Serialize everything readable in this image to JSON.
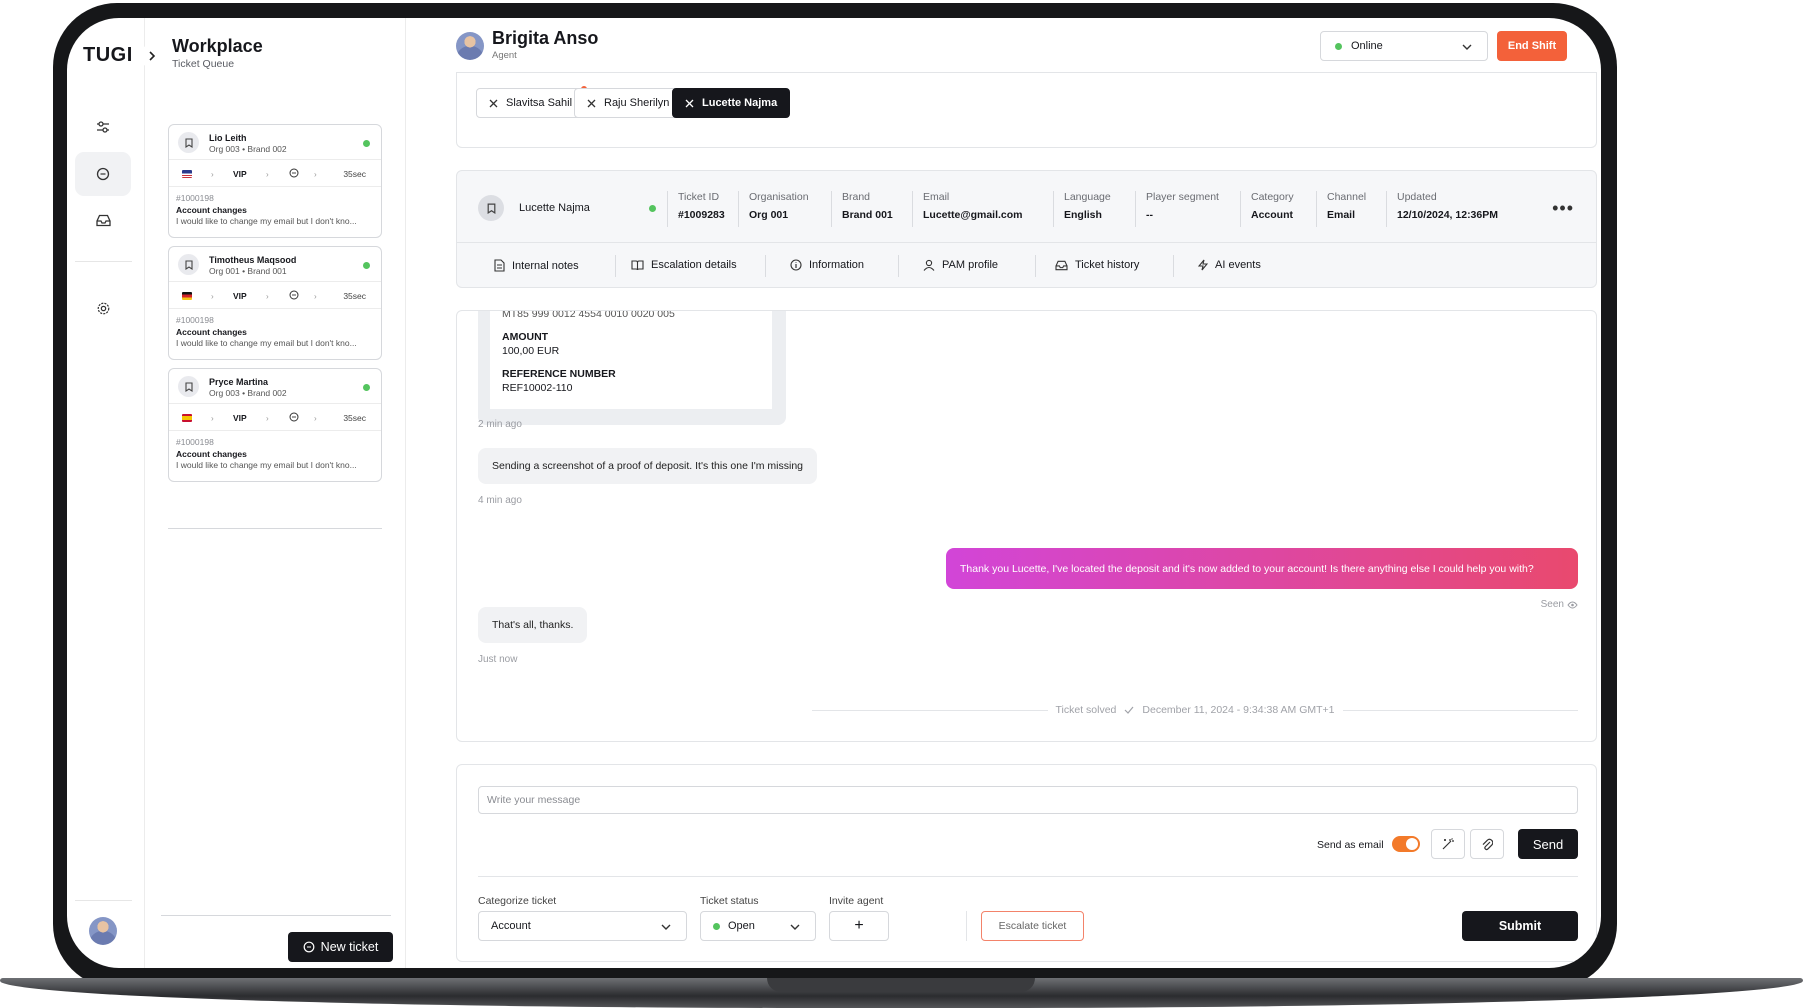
{
  "app": {
    "logo": "TUGI"
  },
  "queue": {
    "title": "Workplace",
    "subtitle": "Ticket Queue",
    "new_ticket_label": "New ticket",
    "tickets": [
      {
        "name": "Lio Leith",
        "org": "Org 003 • Brand 002",
        "flag": "us",
        "tier": "VIP",
        "wait": "35sec",
        "id": "#1000198",
        "category": "Account changes",
        "preview": "I would like to change my email but I don't kno..."
      },
      {
        "name": "Timotheus Maqsood",
        "org": "Org 001 • Brand 001",
        "flag": "de",
        "tier": "VIP",
        "wait": "35sec",
        "id": "#1000198",
        "category": "Account changes",
        "preview": "I would like to change my email but I don't kno..."
      },
      {
        "name": "Pryce Martina",
        "org": "Org 003 • Brand 002",
        "flag": "es",
        "tier": "VIP",
        "wait": "35sec",
        "id": "#1000198",
        "category": "Account changes",
        "preview": "I would like to change my email but I don't kno..."
      }
    ]
  },
  "header": {
    "agent_name": "Brigita Anso",
    "agent_role": "Agent",
    "status": "Online",
    "end_shift_label": "End Shift"
  },
  "chat_tabs": [
    {
      "label": "Slavitsa Sahil",
      "active": false,
      "unread": true
    },
    {
      "label": "Raju Sherilyn",
      "active": false,
      "unread": false
    },
    {
      "label": "Lucette Najma",
      "active": true,
      "unread": false
    }
  ],
  "customer": {
    "name": "Lucette Najma",
    "fields": [
      {
        "key": "Ticket ID",
        "value": "#1009283"
      },
      {
        "key": "Organisation",
        "value": "Org 001"
      },
      {
        "key": "Brand",
        "value": "Brand 001"
      },
      {
        "key": "Email",
        "value": "Lucette@gmail.com"
      },
      {
        "key": "Language",
        "value": "English"
      },
      {
        "key": "Player segment",
        "value": "--"
      },
      {
        "key": "Category",
        "value": "Account"
      },
      {
        "key": "Channel",
        "value": "Email"
      },
      {
        "key": "Updated",
        "value": "12/10/2024, 12:36PM"
      }
    ],
    "sub_tabs": [
      "Internal notes",
      "Escalation details",
      "Information",
      "PAM profile",
      "Ticket history",
      "AI events"
    ]
  },
  "conversation": {
    "receipt": {
      "iban_partial": "MT85 999 0012 4554 0010 0020 005",
      "amount_label": "AMOUNT",
      "amount_value": "100,00 EUR",
      "ref_label": "REFERENCE NUMBER",
      "ref_value": "REF10002-110"
    },
    "receipt_time": "2 min ago",
    "msg1": "Sending a screenshot of a proof of deposit. It's this one I'm missing",
    "msg1_time": "4 min ago",
    "msg2": "Thank you Lucette, I've located the deposit and it's now added to your account! Is there anything else I could help you with?",
    "msg2_status": "Seen",
    "msg3": "That's all, thanks.",
    "msg3_time": "Just now",
    "solved_label": "Ticket solved",
    "solved_time": "December 11, 2024 - 9:34:38 AM GMT+1"
  },
  "compose": {
    "placeholder": "Write your message",
    "send_as_email_label": "Send as email",
    "send_label": "Send",
    "categorize_label": "Categorize ticket",
    "categorize_value": "Account",
    "status_label": "Ticket status",
    "status_value": "Open",
    "invite_label": "Invite agent",
    "invite_button": "+",
    "escalate_label": "Escalate ticket",
    "submit_label": "Submit"
  },
  "colors": {
    "accent": "#f3613a",
    "online": "#54c45e",
    "toggle": "#f37a2a",
    "bubble_start": "#d245d8",
    "bubble_end": "#e9496e",
    "dark": "#16171c"
  }
}
